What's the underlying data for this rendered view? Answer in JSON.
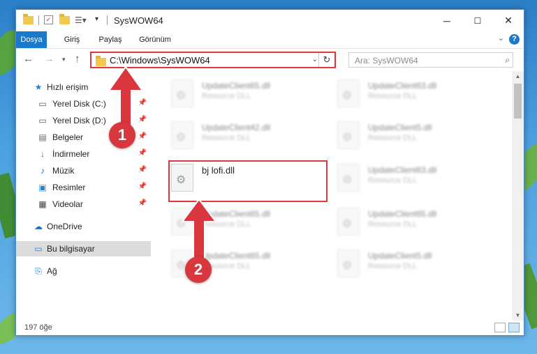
{
  "window": {
    "title": "SysWOW64",
    "minimize": "─",
    "maximize": "☐",
    "close": "✕"
  },
  "ribbon": {
    "tabs": [
      {
        "label": "Dosya",
        "active": true
      },
      {
        "label": "Giriş"
      },
      {
        "label": "Paylaş"
      },
      {
        "label": "Görünüm"
      }
    ],
    "help": "?"
  },
  "address": {
    "path": "C:\\Windows\\SysWOW64",
    "search_placeholder": "Ara: SysWOW64"
  },
  "navpane": {
    "items": [
      {
        "label": "Hızlı erişim",
        "icon": "star-icon",
        "pinned": false
      },
      {
        "label": "Yerel Disk (C:)",
        "icon": "drive-icon",
        "pinned": true
      },
      {
        "label": "Yerel Disk (D:)",
        "icon": "drive-icon",
        "pinned": true
      },
      {
        "label": "Belgeler",
        "icon": "documents-icon",
        "pinned": true
      },
      {
        "label": "İndirmeler",
        "icon": "download-icon",
        "pinned": true
      },
      {
        "label": "Müzik",
        "icon": "music-icon",
        "pinned": true
      },
      {
        "label": "Resimler",
        "icon": "pictures-icon",
        "pinned": true
      },
      {
        "label": "Videolar",
        "icon": "videos-icon",
        "pinned": true
      },
      {
        "label": "OneDrive",
        "icon": "cloud-icon",
        "pinned": false
      },
      {
        "label": "Bu bilgisayar",
        "icon": "computer-icon",
        "pinned": false,
        "selected": true
      },
      {
        "label": "Ağ",
        "icon": "network-icon",
        "pinned": false
      }
    ]
  },
  "files": [
    {
      "name": "UpdateClient65.dll",
      "desc": "Resource DLL",
      "blurred": true
    },
    {
      "name": "UpdateClient63.dll",
      "desc": "Resource DLL",
      "blurred": true
    },
    {
      "name": "UpdateClient42.dll",
      "desc": "Resource DLL",
      "blurred": true
    },
    {
      "name": "UpdateClient5.dll",
      "desc": "Resource DLL",
      "blurred": true
    },
    {
      "name": "bj lofi.dll",
      "desc": "",
      "blurred": false
    },
    {
      "name": "UpdateClient63.dll",
      "desc": "Resource DLL",
      "blurred": true
    },
    {
      "name": "UpdateClient65.dll",
      "desc": "Resource DLL",
      "blurred": true
    },
    {
      "name": "UpdateClient65.dll",
      "desc": "Resource DLL",
      "blurred": true
    },
    {
      "name": "UpdateClient65.dll",
      "desc": "Resource DLL",
      "blurred": true
    },
    {
      "name": "UpdateClient5.dll",
      "desc": "Resource DLL",
      "blurred": true
    }
  ],
  "status": {
    "count": "197 öğe"
  },
  "annotations": {
    "step1": "1",
    "step2": "2",
    "color": "#d9363e"
  }
}
